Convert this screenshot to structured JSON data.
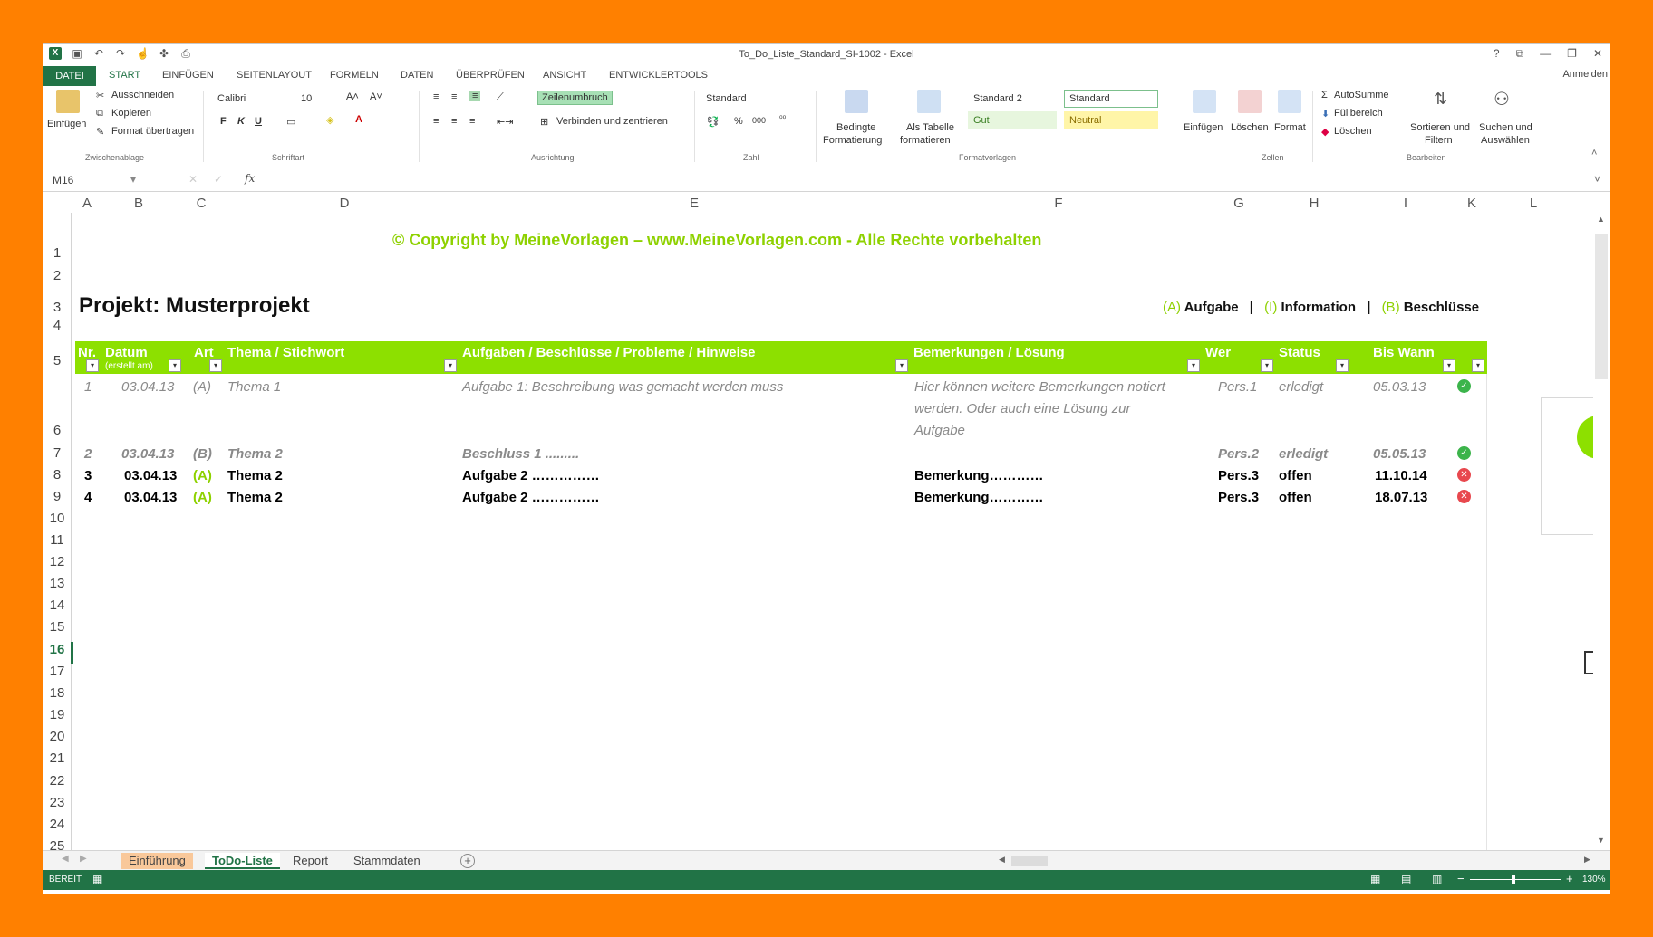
{
  "window": {
    "title": "To_Do_Liste_Standard_SI-1002 - Excel",
    "controls": [
      "?",
      "⧉",
      "—",
      "❐",
      "✕"
    ]
  },
  "tabs": {
    "file": "DATEI",
    "items": [
      "START",
      "EINFÜGEN",
      "SEITENLAYOUT",
      "FORMELN",
      "DATEN",
      "ÜBERPRÜFEN",
      "ANSICHT",
      "ENTWICKLERTOOLS"
    ],
    "account": "Anmelden"
  },
  "ribbon": {
    "clipboard": {
      "paste": "Einfügen",
      "cut": "Ausschneiden",
      "copy": "Kopieren",
      "format_painter": "Format übertragen",
      "group": "Zwischenablage"
    },
    "font": {
      "name": "Calibri",
      "size": "10",
      "bold": "F",
      "italic": "K",
      "underline": "U",
      "group": "Schriftart"
    },
    "alignment": {
      "wrap": "Zeilenumbruch",
      "merge": "Verbinden und zentrieren",
      "group": "Ausrichtung"
    },
    "number": {
      "format": "Standard",
      "percent": "%",
      "thousands": "000",
      "group": "Zahl"
    },
    "styles": {
      "conditional": "Bedingte",
      "conditional2": "Formatierung",
      "as_table": "Als Tabelle",
      "as_table2": "formatieren",
      "standard2": "Standard 2",
      "standard": "Standard",
      "gut": "Gut",
      "neutral": "Neutral",
      "group": "Formatvorlagen"
    },
    "cells": {
      "insert": "Einfügen",
      "delete": "Löschen",
      "format": "Format",
      "group": "Zellen"
    },
    "editing": {
      "autosum": "AutoSumme",
      "fill": "Füllbereich",
      "clear": "Löschen",
      "sort": "Sortieren und",
      "sort2": "Filtern",
      "find": "Suchen und",
      "find2": "Auswählen",
      "group": "Bearbeiten"
    }
  },
  "formula_bar": {
    "name_box": "M16",
    "fx": "fx",
    "value": ""
  },
  "columns": [
    "A",
    "B",
    "C",
    "D",
    "E",
    "F",
    "G",
    "H",
    "I",
    "K",
    "L"
  ],
  "rows": [
    "1",
    "2",
    "3",
    "4",
    "5",
    "6",
    "7",
    "8",
    "9",
    "10",
    "11",
    "12",
    "13",
    "14",
    "15",
    "16",
    "17",
    "18",
    "19",
    "20",
    "21",
    "22",
    "23",
    "24",
    "25"
  ],
  "sheet": {
    "copyright": "© Copyright by MeineVorlagen – www.MeineVorlagen.com - Alle Rechte vorbehalten",
    "project_label": "Projekt:  Musterprojekt",
    "legend": {
      "a_code": "(A)",
      "a_text": "Aufgabe",
      "i_code": "(I)",
      "i_text": "Information",
      "b_code": "(B)",
      "b_text": "Beschlüsse",
      "sep": "|"
    },
    "headers": {
      "nr": "Nr.",
      "datum": "Datum",
      "datum_sub": "(erstellt am)",
      "art": "Art",
      "thema": "Thema / Stichwort",
      "aufgaben": "Aufgaben / Beschlüsse / Probleme / Hinweise",
      "bemerkungen": "Bemerkungen / Lösung",
      "wer": "Wer",
      "status": "Status",
      "bis": "Bis Wann"
    },
    "entries": [
      {
        "nr": "1",
        "datum": "03.04.13",
        "art": "(A)",
        "thema": "Thema 1",
        "aufgabe": "Aufgabe 1:  Beschreibung  was gemacht werden muss",
        "bemerkung1": "Hier können weitere Bemerkungen notiert",
        "bemerkung2": "werden. Oder auch eine Lösung zur",
        "bemerkung3": "Aufgabe",
        "wer": "Pers.1",
        "status": "erledigt",
        "bis": "05.03.13",
        "icon": "check-icon"
      },
      {
        "nr": "2",
        "datum": "03.04.13",
        "art": "(B)",
        "thema": "Thema 2",
        "aufgabe": "Beschluss 1 .........",
        "bemerkung1": "",
        "wer": "Pers.2",
        "status": "erledigt",
        "bis": "05.05.13",
        "icon": "check-icon"
      },
      {
        "nr": "3",
        "datum": "03.04.13",
        "art": "(A)",
        "thema": "Thema 2",
        "aufgabe": "Aufgabe 2 ……………",
        "bemerkung1": "Bemerkung…………",
        "wer": "Pers.3",
        "status": "offen",
        "bis": "11.10.14",
        "icon": "x-icon"
      },
      {
        "nr": "4",
        "datum": "03.04.13",
        "art": "(A)",
        "thema": "Thema 2",
        "aufgabe": "Aufgabe 2 ……………",
        "bemerkung1": "Bemerkung…………",
        "wer": "Pers.3",
        "status": "offen",
        "bis": "18.07.13",
        "icon": "x-icon"
      }
    ]
  },
  "sheet_tabs": [
    "Einführung",
    "ToDo-Liste",
    "Report",
    "Stammdaten"
  ],
  "status_bar": {
    "mode": "BEREIT",
    "zoom": "130%"
  },
  "colors": {
    "excel_green": "#217346",
    "accent_green": "#8de000",
    "frame": "#ff8000"
  }
}
